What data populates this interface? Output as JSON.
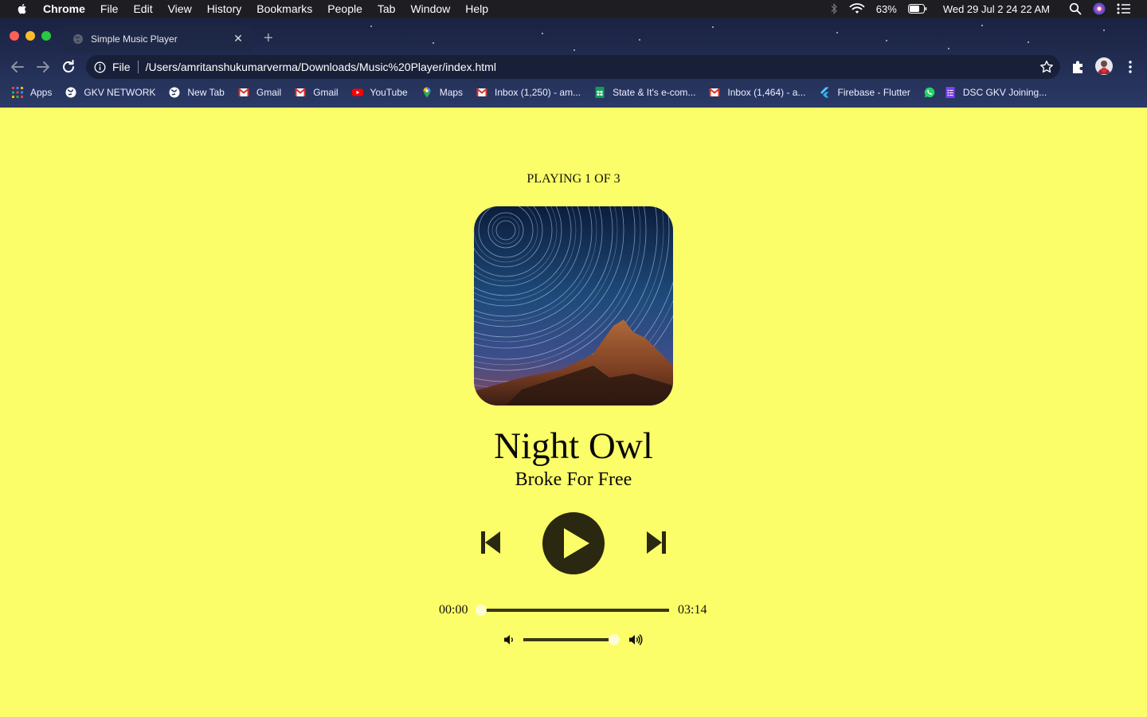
{
  "menubar": {
    "items": [
      "Chrome",
      "File",
      "Edit",
      "View",
      "History",
      "Bookmarks",
      "People",
      "Tab",
      "Window",
      "Help"
    ],
    "battery": "63%",
    "datetime": "Wed 29 Jul  2 24 22 AM"
  },
  "browser": {
    "tab_title": "Simple Music Player",
    "address_scheme": "File",
    "address_url": "/Users/amritanshukumarverma/Downloads/Music%20Player/index.html",
    "bookmarks": [
      {
        "label": "Apps",
        "icon": "apps-grid-icon"
      },
      {
        "label": "GKV NETWORK",
        "icon": "globe-icon"
      },
      {
        "label": "New Tab",
        "icon": "globe-icon"
      },
      {
        "label": "Gmail",
        "icon": "gmail-icon"
      },
      {
        "label": "Gmail",
        "icon": "gmail-icon"
      },
      {
        "label": "YouTube",
        "icon": "youtube-icon"
      },
      {
        "label": "Maps",
        "icon": "maps-pin-icon"
      },
      {
        "label": "Inbox (1,250) - am...",
        "icon": "gmail-icon"
      },
      {
        "label": "State & It's e-com...",
        "icon": "sheets-icon"
      },
      {
        "label": "Inbox (1,464) - a...",
        "icon": "gmail-icon"
      },
      {
        "label": "Firebase - Flutter",
        "icon": "flutter-icon"
      },
      {
        "label": "",
        "icon": "whatsapp-icon"
      },
      {
        "label": "DSC GKV Joining...",
        "icon": "forms-icon"
      }
    ]
  },
  "player": {
    "now_playing": "PLAYING 1 OF 3",
    "track_name": "Night Owl",
    "track_artist": "Broke For Free",
    "current_time": "00:00",
    "total_time": "03:14",
    "seek_fraction": 0.0,
    "volume_fraction": 0.95
  },
  "colors": {
    "background": "#fbfe68",
    "control": "#2a2810",
    "slider_track": "#3a3615",
    "slider_thumb": "#fefcd4"
  }
}
